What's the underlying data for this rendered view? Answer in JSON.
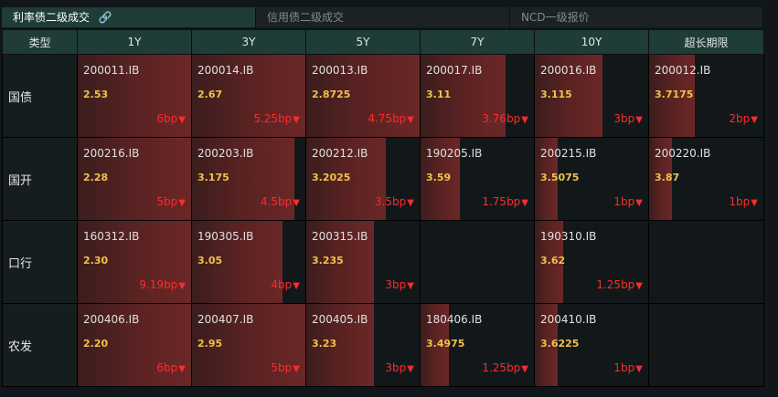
{
  "tabs": [
    {
      "label": "利率债二级成交",
      "active": true
    },
    {
      "label": "信用债二级成交",
      "active": false
    },
    {
      "label": "NCD一级报价",
      "active": false
    }
  ],
  "header": [
    "类型",
    "1Y",
    "3Y",
    "5Y",
    "7Y",
    "10Y",
    "超长期限"
  ],
  "rows": [
    {
      "type": "国债",
      "cells": [
        {
          "code": "200011.IB",
          "yield": "2.53",
          "change": "6bp",
          "fill": 1.0
        },
        {
          "code": "200014.IB",
          "yield": "2.67",
          "change": "5.25bp",
          "fill": 1.0
        },
        {
          "code": "200013.IB",
          "yield": "2.8725",
          "change": "4.75bp",
          "fill": 1.0
        },
        {
          "code": "200017.IB",
          "yield": "3.11",
          "change": "3.76bp",
          "fill": 0.75
        },
        {
          "code": "200016.IB",
          "yield": "3.115",
          "change": "3bp",
          "fill": 0.6
        },
        {
          "code": "200012.IB",
          "yield": "3.7175",
          "change": "2bp",
          "fill": 0.4
        }
      ]
    },
    {
      "type": "国开",
      "cells": [
        {
          "code": "200216.IB",
          "yield": "2.28",
          "change": "5bp",
          "fill": 1.0
        },
        {
          "code": "200203.IB",
          "yield": "3.175",
          "change": "4.5bp",
          "fill": 0.9
        },
        {
          "code": "200212.IB",
          "yield": "3.2025",
          "change": "3.5bp",
          "fill": 0.7
        },
        {
          "code": "190205.IB",
          "yield": "3.59",
          "change": "1.75bp",
          "fill": 0.35
        },
        {
          "code": "200215.IB",
          "yield": "3.5075",
          "change": "1bp",
          "fill": 0.2
        },
        {
          "code": "200220.IB",
          "yield": "3.87",
          "change": "1bp",
          "fill": 0.2
        }
      ]
    },
    {
      "type": "口行",
      "cells": [
        {
          "code": "160312.IB",
          "yield": "2.30",
          "change": "9.19bp",
          "fill": 1.0
        },
        {
          "code": "190305.IB",
          "yield": "3.05",
          "change": "4bp",
          "fill": 0.8
        },
        {
          "code": "200315.IB",
          "yield": "3.235",
          "change": "3bp",
          "fill": 0.6
        },
        null,
        {
          "code": "190310.IB",
          "yield": "3.62",
          "change": "1.25bp",
          "fill": 0.25
        },
        null
      ]
    },
    {
      "type": "农发",
      "cells": [
        {
          "code": "200406.IB",
          "yield": "2.20",
          "change": "6bp",
          "fill": 1.0
        },
        {
          "code": "200407.IB",
          "yield": "2.95",
          "change": "5bp",
          "fill": 1.0
        },
        {
          "code": "200405.IB",
          "yield": "3.23",
          "change": "3bp",
          "fill": 0.6
        },
        {
          "code": "180406.IB",
          "yield": "3.4975",
          "change": "1.25bp",
          "fill": 0.25
        },
        {
          "code": "200410.IB",
          "yield": "3.6225",
          "change": "1bp",
          "fill": 0.2
        },
        null
      ]
    }
  ],
  "colors": {
    "header_bg": "#1f3c36",
    "yield": "#f0c24a",
    "change_down": "#ff2a2a",
    "bar": "#6b2727"
  },
  "icons": {
    "link": "link-icon",
    "down": "triangle-down-icon"
  }
}
